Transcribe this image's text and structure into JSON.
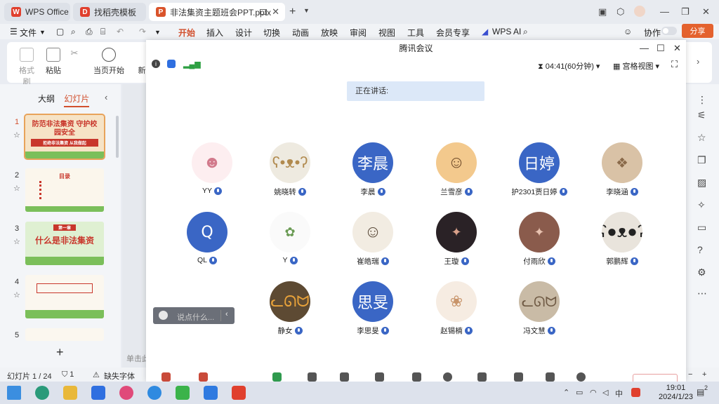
{
  "titlebar": {
    "tabs": [
      {
        "label": "WPS Office",
        "icon": "wps-logo-icon",
        "active": false
      },
      {
        "label": "找稻壳模板",
        "icon": "docer-icon",
        "active": false
      },
      {
        "label": "非法集资主题班会PPT.pptx",
        "icon": "ppt-icon",
        "active": true
      }
    ]
  },
  "menubar": {
    "file": "文件",
    "items": [
      "开始",
      "插入",
      "设计",
      "切换",
      "动画",
      "放映",
      "审阅",
      "视图",
      "工具",
      "会员专享"
    ],
    "active": "开始",
    "wps_ai": "WPS AI",
    "collab": "协作",
    "share": "分享"
  },
  "toolbar": {
    "format_painter": "格式刷",
    "paste": "粘贴",
    "current_page_start": "当页开始",
    "new": "新"
  },
  "leftpanel": {
    "tab_outline": "大纲",
    "tab_slides": "幻灯片",
    "slides": [
      {
        "num": "1",
        "title": "防范非法集资 守护校园安全",
        "subtitle": "拒绝非法集资 从我做起",
        "selected": true
      },
      {
        "num": "2",
        "title": "目录",
        "selected": false
      },
      {
        "num": "3",
        "title": "什么是非法集资",
        "subtitle": "第一章",
        "selected": false
      },
      {
        "num": "4",
        "title": "",
        "selected": false
      },
      {
        "num": "5",
        "title": "",
        "selected": false
      }
    ],
    "canvas_hint": "单击此"
  },
  "statusbar": {
    "slide_info": "幻灯片 1 / 24",
    "missing_font": "缺失字体",
    "zoom_minus": "−",
    "zoom_plus": "+"
  },
  "meeting": {
    "title": "腾讯会议",
    "timer": "04:41(60分钟)",
    "view_mode": "宫格视图",
    "speaking_label": "正在讲话:",
    "chat_placeholder": "说点什么...",
    "participants": [
      {
        "name": "YY",
        "avatar": "cartoon-girl",
        "avatar_text": ""
      },
      {
        "name": "姚晓转",
        "avatar": "cartoon-bears",
        "avatar_text": ""
      },
      {
        "name": "李晨",
        "avatar": "text",
        "avatar_text": "李晨"
      },
      {
        "name": "兰雪彦",
        "avatar": "cartoon-face",
        "avatar_text": ""
      },
      {
        "name": "护2301贾日婷",
        "avatar": "text",
        "avatar_text": "日婷"
      },
      {
        "name": "李晓涵",
        "avatar": "photo-coat",
        "avatar_text": ""
      },
      {
        "name": "QL",
        "avatar": "text",
        "avatar_text": "Q"
      },
      {
        "name": "Y",
        "avatar": "doodle",
        "avatar_text": ""
      },
      {
        "name": "崔皓瑞",
        "avatar": "cartoon-boy",
        "avatar_text": ""
      },
      {
        "name": "王璇",
        "avatar": "photo-dark",
        "avatar_text": ""
      },
      {
        "name": "付雨欣",
        "avatar": "photo-girl",
        "avatar_text": ""
      },
      {
        "name": "郭鹏辉",
        "avatar": "panda",
        "avatar_text": ""
      },
      {
        "name": "静女",
        "avatar": "cartoon-cat",
        "avatar_text": ""
      },
      {
        "name": "李思旻",
        "avatar": "text",
        "avatar_text": "思旻"
      },
      {
        "name": "赵锡楠",
        "avatar": "cartoon-anime",
        "avatar_text": ""
      },
      {
        "name": "冯文慧",
        "avatar": "photo-cat",
        "avatar_text": ""
      }
    ]
  },
  "taskbar": {
    "time": "19:01",
    "date": "2024/1/23",
    "ime": "中",
    "notifications": "2"
  },
  "colors": {
    "accent": "#d2502e",
    "meeting_blue": "#3a66c5",
    "share": "#e4622e"
  }
}
